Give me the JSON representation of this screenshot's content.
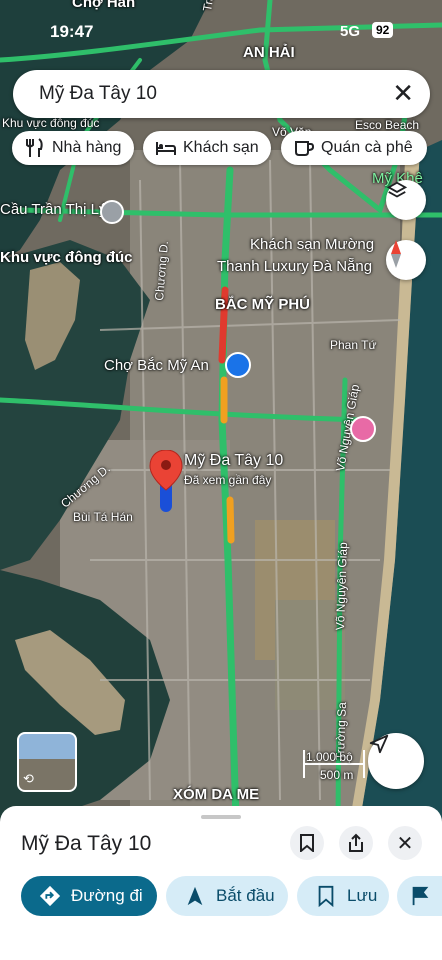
{
  "status_bar": {
    "time": "19:47",
    "network": "5G",
    "battery": "92"
  },
  "search": {
    "query": "Mỹ Đa Tây 10",
    "clear_icon": "close-icon"
  },
  "filter_chips": [
    {
      "label": "Nhà hàng",
      "icon": "restaurant-icon"
    },
    {
      "label": "Khách sạn",
      "icon": "hotel-icon"
    },
    {
      "label": "Quán cà phê",
      "icon": "coffee-icon"
    }
  ],
  "map_labels": {
    "cho_han": "Chợ Hàn",
    "an_hai": "AN HẢI",
    "hung_dao": "Trần Hưng Đạo",
    "esco": "Esco Beach",
    "my_khe": "Mỹ Khê",
    "khu_vuc_dong_duc_top": "Khu vực đông đúc",
    "tran_thi_ly": "Cầu Trần Thị Lý",
    "vo_van": "Võ Văn",
    "khu_vuc_dong_duc": "Khu vực đông đúc",
    "hotel_line1": "Khách sạn Mường",
    "hotel_line2": "Thanh Luxury Đà Nẵng",
    "chuong_d_top": "Chương D.",
    "bac_my_phu": "BẮC MỸ PHÚ",
    "phan_tu": "Phan Tứ",
    "cho_bac_my_an": "Chợ Bắc Mỹ An",
    "vo_nguyen_giap_1": "Võ Nguyên Giáp",
    "chuong_d_mid": "Chương D.",
    "bui_ta_han": "Bùi Tá Hán",
    "vo_nguyen_giap_2": "Võ Nguyên Giáp",
    "truong_sa": "Trường Sa",
    "xom_da_me": "XÓM DA ME",
    "pin_title": "Mỹ Đa Tây 10",
    "pin_subtitle": "Đã xem gần đây"
  },
  "scale": {
    "feet": "1.000 bộ",
    "meters": "500 m"
  },
  "map_controls": {
    "layers_icon": "layers-icon",
    "compass_icon": "compass-icon",
    "location_icon": "navigation-arrow-icon",
    "street_view_icon": "street-view-icon"
  },
  "place_sheet": {
    "title": "Mỹ Đa Tây 10",
    "save_icon": "bookmark-icon",
    "share_icon": "share-icon",
    "close_icon": "close-icon",
    "actions": [
      {
        "label": "Đường đi",
        "icon": "directions-icon",
        "primary": true
      },
      {
        "label": "Bắt đầu",
        "icon": "navigation-icon",
        "primary": false
      },
      {
        "label": "Lưu",
        "icon": "bookmark-icon",
        "primary": false
      },
      {
        "label": "",
        "icon": "flag-icon",
        "primary": false
      }
    ]
  },
  "colors": {
    "traffic_green": "#2fbf6a",
    "traffic_red": "#e03a2e",
    "traffic_orange": "#f0a020",
    "pin_red": "#ea4335",
    "primary_button": "#0b6a8c",
    "secondary_button": "#d6ecf7"
  }
}
